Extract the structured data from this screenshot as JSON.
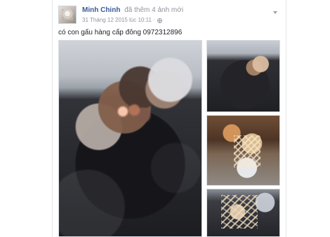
{
  "post": {
    "author_name": "Minh Chinh",
    "action_text": "đã thêm 4 ảnh mới",
    "timestamp": "31 Tháng 12 2015 lúc 10:11",
    "privacy_separator": "·",
    "caption": "có con gấu hàng cấp đông 0972312896"
  },
  "icons": {
    "avatar": "avatar",
    "privacy": "globe-icon",
    "menu": "chevron-down-icon"
  },
  "colors": {
    "author": "#3b5998",
    "meta": "#90949c",
    "text": "#1d2129",
    "border": "#d9dde3"
  }
}
